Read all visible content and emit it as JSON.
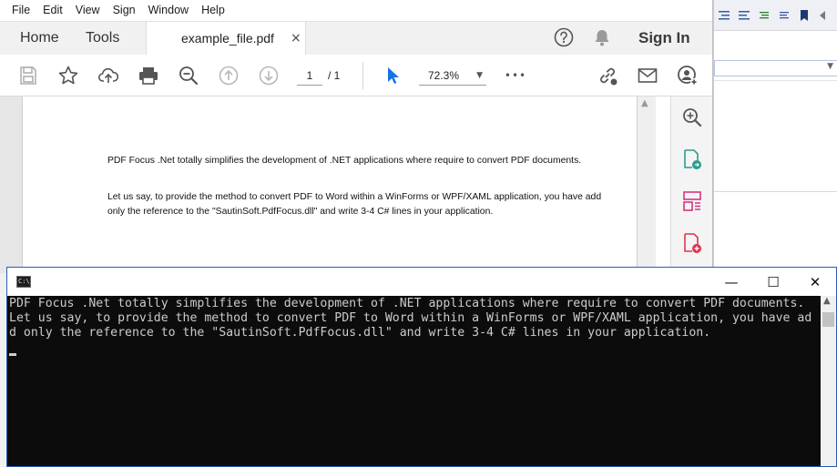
{
  "acrobat": {
    "menu": [
      "File",
      "Edit",
      "View",
      "Sign",
      "Window",
      "Help"
    ],
    "tabs": {
      "home": "Home",
      "tools": "Tools",
      "file": "example_file.pdf",
      "close_glyph": "×"
    },
    "sign_in": "Sign In",
    "toolbar": {
      "page_current": "1",
      "page_total": "/ 1",
      "zoom": "72.3%",
      "zoom_arrow": "▼",
      "more": "•••"
    },
    "document": {
      "para1": "PDF Focus .Net totally simplifies the development of .NET applications where require to convert PDF documents.",
      "para2": "Let us say, to provide the method to convert PDF to Word within a WinForms or WPF/XAML application, you have add only the reference to the \"SautinSoft.PdfFocus.dll\" and write 3-4 C# lines in your application."
    }
  },
  "console": {
    "icon_text": "C:\\",
    "minimize_glyph": "—",
    "maximize_glyph": "☐",
    "close_glyph": "✕",
    "lines": [
      "PDF Focus .Net totally simplifies the development of .NET applications where require to convert PDF documents.",
      "Let us say, to provide the method to convert PDF to Word within a WinForms or WPF/XAML application, you have ad",
      "d only the reference to the \"SautinSoft.PdfFocus.dll\" and write 3-4 C# lines in your application."
    ]
  },
  "colors": {
    "acrobat_blue": "#1473e6",
    "acrobat_red": "#e0344b",
    "acrobat_teal": "#2a9d8f",
    "console_bg": "#0c0c0c",
    "console_text": "#cccccc"
  }
}
